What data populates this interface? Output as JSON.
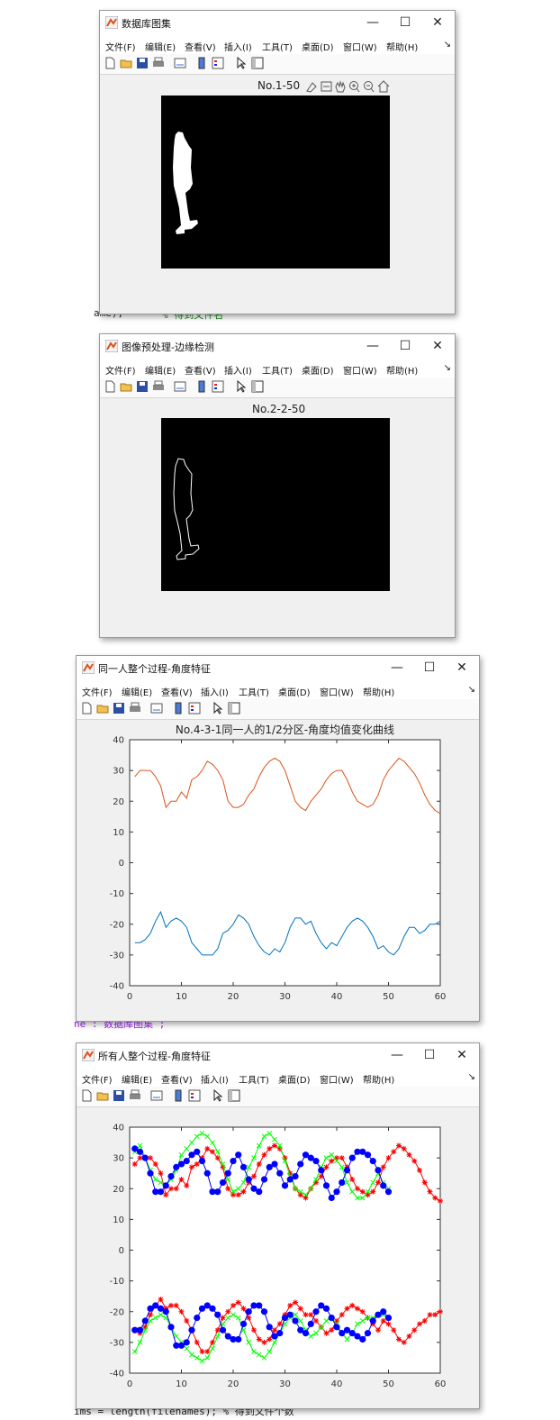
{
  "menu": [
    "文件(F)",
    "编辑(E)",
    "查看(V)",
    "插入(I)",
    "工具(T)",
    "桌面(D)",
    "窗口(W)",
    "帮助(H)"
  ],
  "menu_more": "↘",
  "window_buttons": {
    "minimize": "—",
    "maximize": "☐",
    "close": "✕"
  },
  "background_code": {
    "line1": "ame);",
    "line1_comment": "% 得到文件名",
    "line2": "ne : 数据库图集 ;",
    "line3": "ims = length(filenames); % 得到文件个数"
  },
  "windows": [
    {
      "title": "数据库图集",
      "axes_title": "No.1-50"
    },
    {
      "title": "图像预处理-边缘检测",
      "axes_title": "No.2-2-50"
    },
    {
      "title": "同一人整个过程-角度特征",
      "axes_title": "No.4-3-1同一人的1/2分区-角度均值变化曲线"
    },
    {
      "title": "所有人整个过程-角度特征",
      "axes_title": ""
    }
  ],
  "chart_data": [
    {
      "type": "line",
      "title": "No.4-3-1同一人的1/2分区-角度均值变化曲线",
      "xlim": [
        0,
        60
      ],
      "ylim": [
        -40,
        40
      ],
      "xticks": [
        0,
        10,
        20,
        30,
        40,
        50,
        60
      ],
      "yticks": [
        40,
        30,
        20,
        10,
        0,
        -10,
        -20,
        -30,
        -40
      ],
      "series": [
        {
          "color": "#d95319",
          "x": [
            1,
            2,
            3,
            4,
            5,
            6,
            7,
            8,
            9,
            10,
            11,
            12,
            13,
            14,
            15,
            16,
            17,
            18,
            19,
            20,
            21,
            22,
            23,
            24,
            25,
            26,
            27,
            28,
            29,
            30,
            31,
            32,
            33,
            34,
            35,
            36,
            37,
            38,
            39,
            40,
            41,
            42,
            43,
            44,
            45,
            46,
            47,
            48,
            49,
            50,
            51,
            52,
            53,
            54,
            55,
            56,
            57,
            58,
            59,
            60
          ],
          "y": [
            28,
            30,
            30,
            30,
            28,
            25,
            18,
            20,
            20,
            23,
            21,
            27,
            28,
            30,
            33,
            32,
            30,
            27,
            20,
            18,
            18,
            19,
            22,
            24,
            28,
            31,
            33,
            34,
            33,
            30,
            25,
            20,
            18,
            17,
            20,
            22,
            24,
            27,
            29,
            30,
            30,
            27,
            23,
            20,
            19,
            18,
            19,
            22,
            27,
            30,
            32,
            34,
            33,
            31,
            29,
            26,
            22,
            19,
            17,
            16
          ]
        },
        {
          "color": "#0072bd",
          "x": [
            1,
            2,
            3,
            4,
            5,
            6,
            7,
            8,
            9,
            10,
            11,
            12,
            13,
            14,
            15,
            16,
            17,
            18,
            19,
            20,
            21,
            22,
            23,
            24,
            25,
            26,
            27,
            28,
            29,
            30,
            31,
            32,
            33,
            34,
            35,
            36,
            37,
            38,
            39,
            40,
            41,
            42,
            43,
            44,
            45,
            46,
            47,
            48,
            49,
            50,
            51,
            52,
            53,
            54,
            55,
            56,
            57,
            58,
            59,
            60
          ],
          "y": [
            -26,
            -26,
            -25,
            -23,
            -19,
            -16,
            -21,
            -19,
            -18,
            -19,
            -21,
            -26,
            -28,
            -30,
            -30,
            -30,
            -28,
            -23,
            -22,
            -20,
            -17,
            -18,
            -20,
            -24,
            -27,
            -29,
            -30,
            -28,
            -29,
            -26,
            -21,
            -18,
            -18,
            -20,
            -19,
            -23,
            -26,
            -28,
            -26,
            -27,
            -24,
            -21,
            -19,
            -18,
            -19,
            -21,
            -24,
            -28,
            -27,
            -29,
            -30,
            -28,
            -24,
            -21,
            -21,
            -23,
            -22,
            -20,
            -20,
            -19
          ]
        }
      ]
    },
    {
      "type": "line",
      "title": "",
      "xlim": [
        0,
        60
      ],
      "ylim": [
        -40,
        40
      ],
      "xticks": [
        0,
        10,
        20,
        30,
        40,
        50,
        60
      ],
      "yticks": [
        40,
        30,
        20,
        10,
        0,
        -10,
        -20,
        -30,
        -40
      ],
      "series": [
        {
          "color": "#ff0000",
          "marker": "star",
          "x": [
            1,
            2,
            3,
            4,
            5,
            6,
            7,
            8,
            9,
            10,
            11,
            12,
            13,
            14,
            15,
            16,
            17,
            18,
            19,
            20,
            21,
            22,
            23,
            24,
            25,
            26,
            27,
            28,
            29,
            30,
            31,
            32,
            33,
            34,
            35,
            36,
            37,
            38,
            39,
            40,
            41,
            42,
            43,
            44,
            45,
            46,
            47,
            48,
            49,
            50,
            51,
            52,
            53,
            54,
            55,
            56,
            57,
            58,
            59,
            60
          ],
          "y": [
            28,
            30,
            30,
            30,
            28,
            25,
            18,
            20,
            20,
            23,
            21,
            27,
            28,
            30,
            33,
            32,
            30,
            27,
            20,
            18,
            18,
            19,
            22,
            24,
            28,
            31,
            33,
            34,
            33,
            30,
            25,
            20,
            18,
            17,
            20,
            22,
            24,
            27,
            29,
            30,
            30,
            27,
            23,
            20,
            19,
            18,
            19,
            22,
            27,
            30,
            32,
            34,
            33,
            31,
            29,
            26,
            22,
            19,
            17,
            16
          ]
        },
        {
          "color": "#ff0000",
          "marker": "star",
          "x": [
            1,
            2,
            3,
            4,
            5,
            6,
            7,
            8,
            9,
            10,
            11,
            12,
            13,
            14,
            15,
            16,
            17,
            18,
            19,
            20,
            21,
            22,
            23,
            24,
            25,
            26,
            27,
            28,
            29,
            30,
            31,
            32,
            33,
            34,
            35,
            36,
            37,
            38,
            39,
            40,
            41,
            42,
            43,
            44,
            45,
            46,
            47,
            48,
            49,
            50,
            51,
            52,
            53,
            54,
            55,
            56,
            57,
            58,
            59,
            60
          ],
          "y": [
            -26,
            -27,
            -25,
            -21,
            -18,
            -16,
            -19,
            -18,
            -18,
            -20,
            -23,
            -26,
            -30,
            -33,
            -33,
            -30,
            -26,
            -22,
            -20,
            -18,
            -17,
            -19,
            -22,
            -26,
            -29,
            -30,
            -29,
            -26,
            -24,
            -21,
            -18,
            -17,
            -19,
            -21,
            -21,
            -23,
            -25,
            -27,
            -26,
            -23,
            -21,
            -19,
            -18,
            -19,
            -20,
            -22,
            -24,
            -26,
            -23,
            -24,
            -26,
            -29,
            -30,
            -28,
            -26,
            -24,
            -23,
            -21,
            -21,
            -20
          ]
        },
        {
          "color": "#00ff00",
          "marker": "x",
          "x": [
            1,
            2,
            3,
            4,
            5,
            6,
            7,
            8,
            9,
            10,
            11,
            12,
            13,
            14,
            15,
            16,
            17,
            18,
            19,
            20,
            21,
            22,
            23,
            24,
            25,
            26,
            27,
            28,
            29,
            30,
            31,
            32,
            33,
            34,
            35,
            36,
            37,
            38,
            39,
            40,
            41,
            42,
            43,
            44,
            45,
            46,
            47,
            48,
            49,
            50
          ],
          "y": [
            32,
            34,
            30,
            26,
            23,
            22,
            21,
            23,
            26,
            31,
            33,
            35,
            37,
            38,
            37,
            35,
            32,
            28,
            23,
            19,
            20,
            22,
            27,
            30,
            34,
            37,
            38,
            36,
            34,
            29,
            24,
            20,
            19,
            18,
            20,
            23,
            27,
            30,
            31,
            29,
            27,
            22,
            19,
            17,
            17,
            19,
            22,
            25,
            22,
            20
          ]
        },
        {
          "color": "#00ff00",
          "marker": "x",
          "x": [
            1,
            2,
            3,
            4,
            5,
            6,
            7,
            8,
            9,
            10,
            11,
            12,
            13,
            14,
            15,
            16,
            17,
            18,
            19,
            20,
            21,
            22,
            23,
            24,
            25,
            26,
            27,
            28,
            29,
            30,
            31,
            32,
            33,
            34,
            35,
            36,
            37,
            38,
            39,
            40,
            41,
            42,
            43,
            44,
            45,
            46,
            47,
            48,
            49,
            50
          ],
          "y": [
            -33,
            -30,
            -26,
            -23,
            -22,
            -21,
            -22,
            -25,
            -28,
            -30,
            -32,
            -34,
            -35,
            -36,
            -35,
            -32,
            -28,
            -24,
            -22,
            -21,
            -22,
            -26,
            -30,
            -33,
            -34,
            -35,
            -33,
            -30,
            -27,
            -24,
            -22,
            -21,
            -23,
            -26,
            -28,
            -27,
            -25,
            -23,
            -22,
            -24,
            -27,
            -29,
            -27,
            -24,
            -23,
            -22,
            -22,
            -21,
            -21,
            -22
          ]
        },
        {
          "color": "#0000ff",
          "marker": "dot",
          "x": [
            1,
            2,
            3,
            4,
            5,
            6,
            7,
            8,
            9,
            10,
            11,
            12,
            13,
            14,
            15,
            16,
            17,
            18,
            19,
            20,
            21,
            22,
            23,
            24,
            25,
            26,
            27,
            28,
            29,
            30,
            31,
            32,
            33,
            34,
            35,
            36,
            37,
            38,
            39,
            40,
            41,
            42,
            43,
            44,
            45,
            46,
            47,
            48,
            49,
            50
          ],
          "y": [
            33,
            32,
            30,
            25,
            19,
            19,
            21,
            24,
            27,
            28,
            29,
            31,
            32,
            29,
            25,
            19,
            19,
            22,
            25,
            29,
            31,
            27,
            23,
            20,
            19,
            23,
            27,
            28,
            25,
            21,
            23,
            24,
            28,
            31,
            30,
            29,
            26,
            21,
            17,
            19,
            22,
            26,
            30,
            32,
            32,
            31,
            29,
            26,
            21,
            19
          ]
        },
        {
          "color": "#0000ff",
          "marker": "dot",
          "x": [
            1,
            2,
            3,
            4,
            5,
            6,
            7,
            8,
            9,
            10,
            11,
            12,
            13,
            14,
            15,
            16,
            17,
            18,
            19,
            20,
            21,
            22,
            23,
            24,
            25,
            26,
            27,
            28,
            29,
            30,
            31,
            32,
            33,
            34,
            35,
            36,
            37,
            38,
            39,
            40,
            41,
            42,
            43,
            44,
            45,
            46,
            47,
            48,
            49,
            50
          ],
          "y": [
            -26,
            -26,
            -23,
            -19,
            -18,
            -19,
            -20,
            -25,
            -31,
            -31,
            -30,
            -26,
            -22,
            -19,
            -18,
            -19,
            -21,
            -26,
            -28,
            -29,
            -29,
            -24,
            -20,
            -18,
            -18,
            -20,
            -25,
            -28,
            -27,
            -22,
            -21,
            -23,
            -26,
            -27,
            -24,
            -20,
            -18,
            -19,
            -22,
            -25,
            -27,
            -26,
            -27,
            -28,
            -29,
            -27,
            -23,
            -21,
            -20,
            -22
          ]
        }
      ]
    }
  ]
}
